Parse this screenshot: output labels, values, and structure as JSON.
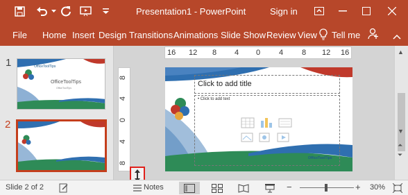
{
  "titlebar": {
    "title": "Presentation1  -  PowerPoint",
    "signin": "Sign in",
    "icons": [
      "save-icon",
      "undo-icon",
      "redo-icon",
      "start-from-beginning-icon",
      "customize-qat-icon",
      "ribbon-display-options-icon",
      "minimize-icon",
      "maximize-icon",
      "close-icon"
    ]
  },
  "ribbon": {
    "tabs": [
      "File",
      "Home",
      "Insert",
      "Design",
      "Transitions",
      "Animations",
      "Slide Show",
      "Review",
      "View"
    ],
    "tell_me": "Tell me",
    "icons": [
      "lightbulb-icon",
      "share-icon",
      "collapse-ribbon-icon"
    ]
  },
  "thumbnails": [
    {
      "number": "1",
      "title": "OfficeToolTips",
      "subtitle": "OfficeToolTips",
      "brand_small": "OfficeToolTips"
    },
    {
      "number": "2"
    }
  ],
  "ruler": {
    "horizontal": [
      "16",
      "12",
      "8",
      "4",
      "0",
      "4",
      "8",
      "12",
      "16"
    ],
    "vertical": [
      "8",
      "4",
      "0",
      "4",
      "8"
    ]
  },
  "slide": {
    "title_placeholder": "Click to add title",
    "body_placeholder": "• Click to add text",
    "brand": "OfficeToolTips"
  },
  "statusbar": {
    "slide_indicator": "Slide 2 of 2",
    "notes": "Notes",
    "zoom": "30%",
    "zoom_out": "−",
    "zoom_in": "+"
  },
  "colors": {
    "accent": "#b7472a",
    "selected_border": "#c43e1c",
    "highlight_box": "#e0201b",
    "slide_design_blue": "#2f6fb0",
    "slide_design_green": "#2e8b57",
    "slide_design_red": "#c0392b"
  }
}
